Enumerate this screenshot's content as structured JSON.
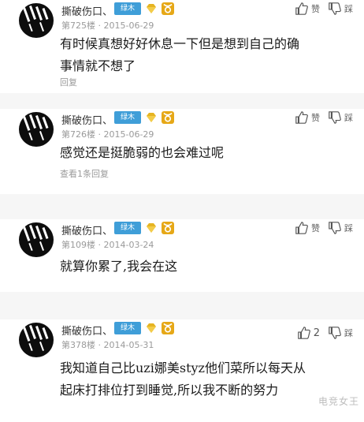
{
  "comments": [
    {
      "username": "撕破伤口、",
      "badge": "绿木",
      "floor": "第725楼",
      "date": "2015-06-29",
      "like_label": "赞",
      "dislike_label": "踩",
      "text_lines": [
        "有时候真想好好休息一下但是想到自己的确",
        "事情就不想了"
      ],
      "reply": "回复"
    },
    {
      "username": "撕破伤口、",
      "badge": "绿木",
      "floor": "第726楼",
      "date": "2015-06-29",
      "like_label": "赞",
      "dislike_label": "踩",
      "text_lines": [
        "感觉还是挺脆弱的也会难过呢"
      ],
      "reply": "查看1条回复"
    },
    {
      "username": "撕破伤口、",
      "badge": "绿木",
      "floor": "第109楼",
      "date": "2014-03-24",
      "like_label": "赞",
      "dislike_label": "踩",
      "text_lines": [
        "就算你累了,我会在这"
      ],
      "reply": ""
    },
    {
      "username": "撕破伤口、",
      "badge": "绿木",
      "floor": "第378楼",
      "date": "2014-05-31",
      "like_count": "2",
      "dislike_label": "踩",
      "text_lines": [
        "我知道自己比uzi娜美styz他们菜所以每天从",
        "起床打排位打到睡觉,所以我不断的努力"
      ],
      "reply": ""
    }
  ],
  "watermark": "电竞女王",
  "colors": {
    "badge": "#3f9ed8",
    "background": "#f6f6f6",
    "card": "#ffffff"
  }
}
